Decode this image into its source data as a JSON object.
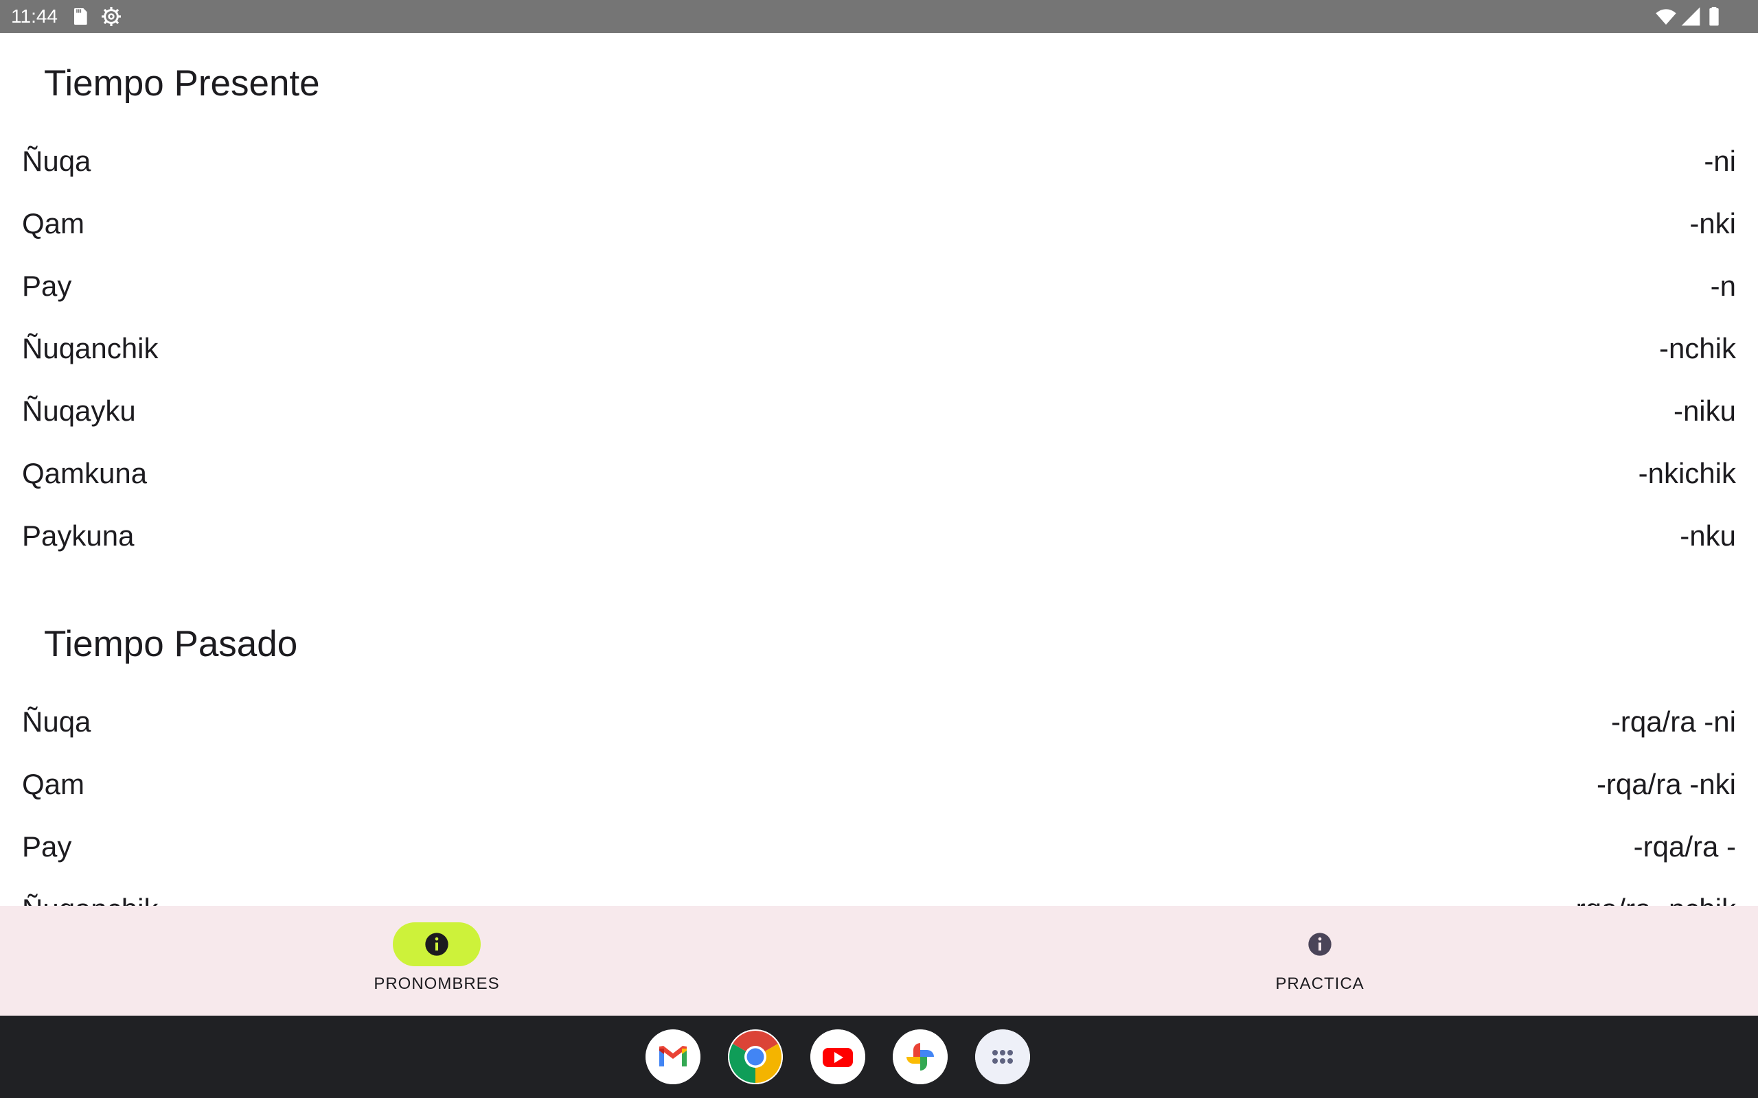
{
  "status_bar": {
    "time": "11:44",
    "icons_left": [
      "sd-card-icon",
      "settings-gear-icon"
    ],
    "icons_right": [
      "wifi-icon",
      "cell-signal-icon",
      "battery-icon"
    ],
    "background": "#757575"
  },
  "sections": [
    {
      "title": "Tiempo Presente",
      "rows": [
        {
          "pronoun": "Ñuqa",
          "suffix": "-ni"
        },
        {
          "pronoun": "Qam",
          "suffix": "-nki"
        },
        {
          "pronoun": "Pay",
          "suffix": "-n"
        },
        {
          "pronoun": "Ñuqanchik",
          "suffix": "-nchik"
        },
        {
          "pronoun": "Ñuqayku",
          "suffix": "-niku"
        },
        {
          "pronoun": "Qamkuna",
          "suffix": "-nkichik"
        },
        {
          "pronoun": "Paykuna",
          "suffix": "-nku"
        }
      ]
    },
    {
      "title": "Tiempo Pasado",
      "rows": [
        {
          "pronoun": "Ñuqa",
          "suffix": "-rqa/ra -ni"
        },
        {
          "pronoun": "Qam",
          "suffix": "-rqa/ra -nki"
        },
        {
          "pronoun": "Pay",
          "suffix": "-rqa/ra -"
        },
        {
          "pronoun": "Ñuqanchik",
          "suffix": "-rqa/ra -nchik"
        }
      ]
    }
  ],
  "bottom_nav": {
    "items": [
      {
        "label": "PRONOMBRES",
        "icon": "info-icon",
        "active": true
      },
      {
        "label": "PRACTICA",
        "icon": "info-icon",
        "active": false
      }
    ],
    "background": "#f7e9ec",
    "active_indicator": "#cdf23a"
  },
  "taskbar": {
    "apps": [
      "gmail-icon",
      "chrome-icon",
      "youtube-icon",
      "photos-icon",
      "app-drawer-icon"
    ],
    "background": "#202124"
  }
}
